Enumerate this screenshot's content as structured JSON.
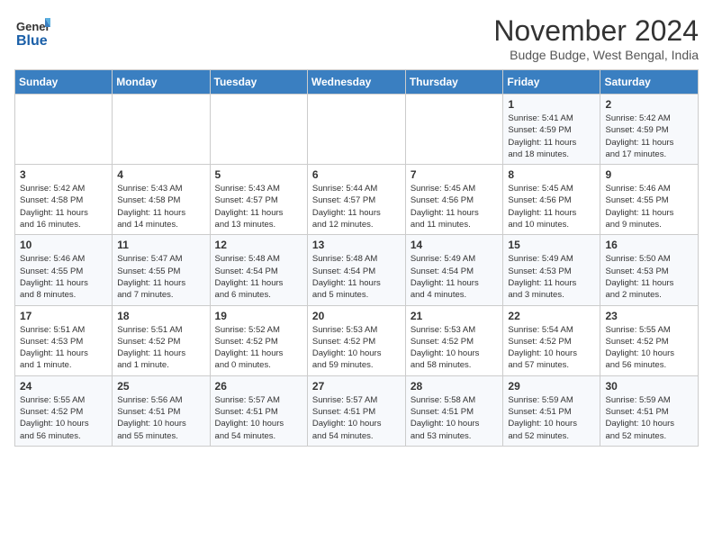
{
  "header": {
    "logo_general": "General",
    "logo_blue": "Blue",
    "month_title": "November 2024",
    "subtitle": "Budge Budge, West Bengal, India"
  },
  "weekdays": [
    "Sunday",
    "Monday",
    "Tuesday",
    "Wednesday",
    "Thursday",
    "Friday",
    "Saturday"
  ],
  "weeks": [
    [
      {
        "day": "",
        "info": ""
      },
      {
        "day": "",
        "info": ""
      },
      {
        "day": "",
        "info": ""
      },
      {
        "day": "",
        "info": ""
      },
      {
        "day": "",
        "info": ""
      },
      {
        "day": "1",
        "info": "Sunrise: 5:41 AM\nSunset: 4:59 PM\nDaylight: 11 hours\nand 18 minutes."
      },
      {
        "day": "2",
        "info": "Sunrise: 5:42 AM\nSunset: 4:59 PM\nDaylight: 11 hours\nand 17 minutes."
      }
    ],
    [
      {
        "day": "3",
        "info": "Sunrise: 5:42 AM\nSunset: 4:58 PM\nDaylight: 11 hours\nand 16 minutes."
      },
      {
        "day": "4",
        "info": "Sunrise: 5:43 AM\nSunset: 4:58 PM\nDaylight: 11 hours\nand 14 minutes."
      },
      {
        "day": "5",
        "info": "Sunrise: 5:43 AM\nSunset: 4:57 PM\nDaylight: 11 hours\nand 13 minutes."
      },
      {
        "day": "6",
        "info": "Sunrise: 5:44 AM\nSunset: 4:57 PM\nDaylight: 11 hours\nand 12 minutes."
      },
      {
        "day": "7",
        "info": "Sunrise: 5:45 AM\nSunset: 4:56 PM\nDaylight: 11 hours\nand 11 minutes."
      },
      {
        "day": "8",
        "info": "Sunrise: 5:45 AM\nSunset: 4:56 PM\nDaylight: 11 hours\nand 10 minutes."
      },
      {
        "day": "9",
        "info": "Sunrise: 5:46 AM\nSunset: 4:55 PM\nDaylight: 11 hours\nand 9 minutes."
      }
    ],
    [
      {
        "day": "10",
        "info": "Sunrise: 5:46 AM\nSunset: 4:55 PM\nDaylight: 11 hours\nand 8 minutes."
      },
      {
        "day": "11",
        "info": "Sunrise: 5:47 AM\nSunset: 4:55 PM\nDaylight: 11 hours\nand 7 minutes."
      },
      {
        "day": "12",
        "info": "Sunrise: 5:48 AM\nSunset: 4:54 PM\nDaylight: 11 hours\nand 6 minutes."
      },
      {
        "day": "13",
        "info": "Sunrise: 5:48 AM\nSunset: 4:54 PM\nDaylight: 11 hours\nand 5 minutes."
      },
      {
        "day": "14",
        "info": "Sunrise: 5:49 AM\nSunset: 4:54 PM\nDaylight: 11 hours\nand 4 minutes."
      },
      {
        "day": "15",
        "info": "Sunrise: 5:49 AM\nSunset: 4:53 PM\nDaylight: 11 hours\nand 3 minutes."
      },
      {
        "day": "16",
        "info": "Sunrise: 5:50 AM\nSunset: 4:53 PM\nDaylight: 11 hours\nand 2 minutes."
      }
    ],
    [
      {
        "day": "17",
        "info": "Sunrise: 5:51 AM\nSunset: 4:53 PM\nDaylight: 11 hours\nand 1 minute."
      },
      {
        "day": "18",
        "info": "Sunrise: 5:51 AM\nSunset: 4:52 PM\nDaylight: 11 hours\nand 1 minute."
      },
      {
        "day": "19",
        "info": "Sunrise: 5:52 AM\nSunset: 4:52 PM\nDaylight: 11 hours\nand 0 minutes."
      },
      {
        "day": "20",
        "info": "Sunrise: 5:53 AM\nSunset: 4:52 PM\nDaylight: 10 hours\nand 59 minutes."
      },
      {
        "day": "21",
        "info": "Sunrise: 5:53 AM\nSunset: 4:52 PM\nDaylight: 10 hours\nand 58 minutes."
      },
      {
        "day": "22",
        "info": "Sunrise: 5:54 AM\nSunset: 4:52 PM\nDaylight: 10 hours\nand 57 minutes."
      },
      {
        "day": "23",
        "info": "Sunrise: 5:55 AM\nSunset: 4:52 PM\nDaylight: 10 hours\nand 56 minutes."
      }
    ],
    [
      {
        "day": "24",
        "info": "Sunrise: 5:55 AM\nSunset: 4:52 PM\nDaylight: 10 hours\nand 56 minutes."
      },
      {
        "day": "25",
        "info": "Sunrise: 5:56 AM\nSunset: 4:51 PM\nDaylight: 10 hours\nand 55 minutes."
      },
      {
        "day": "26",
        "info": "Sunrise: 5:57 AM\nSunset: 4:51 PM\nDaylight: 10 hours\nand 54 minutes."
      },
      {
        "day": "27",
        "info": "Sunrise: 5:57 AM\nSunset: 4:51 PM\nDaylight: 10 hours\nand 54 minutes."
      },
      {
        "day": "28",
        "info": "Sunrise: 5:58 AM\nSunset: 4:51 PM\nDaylight: 10 hours\nand 53 minutes."
      },
      {
        "day": "29",
        "info": "Sunrise: 5:59 AM\nSunset: 4:51 PM\nDaylight: 10 hours\nand 52 minutes."
      },
      {
        "day": "30",
        "info": "Sunrise: 5:59 AM\nSunset: 4:51 PM\nDaylight: 10 hours\nand 52 minutes."
      }
    ]
  ]
}
